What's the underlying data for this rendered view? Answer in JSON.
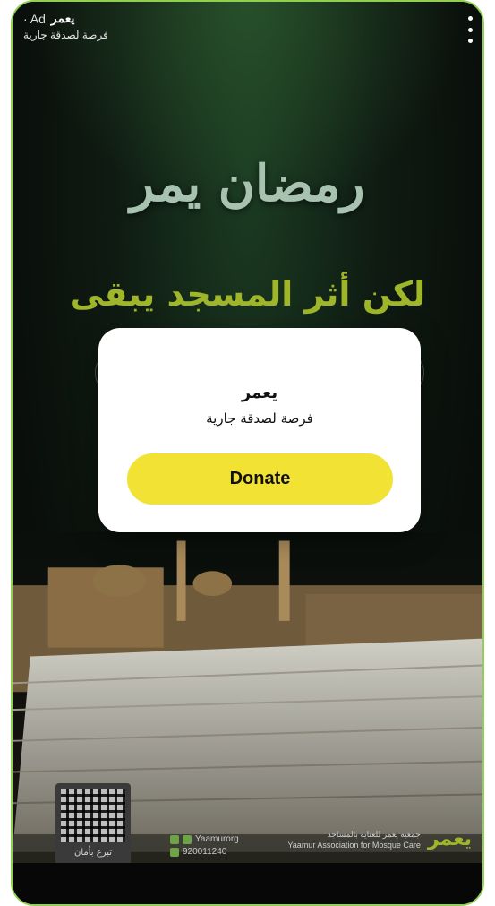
{
  "ad": {
    "brand_name": "يعمر",
    "ad_label": "· Ad",
    "subtitle": "فرصة لصدقة جارية",
    "menu_icon": "more-vertical-icon"
  },
  "creative": {
    "calligraphy": "رمضان يمر",
    "headline": "لكن أثر المسجد يبقى",
    "qr_caption": "تبرع بأمان",
    "social_handle": "Yaamurorg",
    "phone": "920011240",
    "org_ar": "جمعية يعمر للعناية بالمساجد",
    "org_en": "Yaamur Association for Mosque Care",
    "org_logo": "يعمر"
  },
  "modal": {
    "title": "يعمر",
    "subtitle": "فرصة لصدقة جارية",
    "donate_label": "Donate"
  },
  "colors": {
    "accent": "#f1e233",
    "headline": "#9fb62a",
    "frame_border": "#8fd14f"
  }
}
